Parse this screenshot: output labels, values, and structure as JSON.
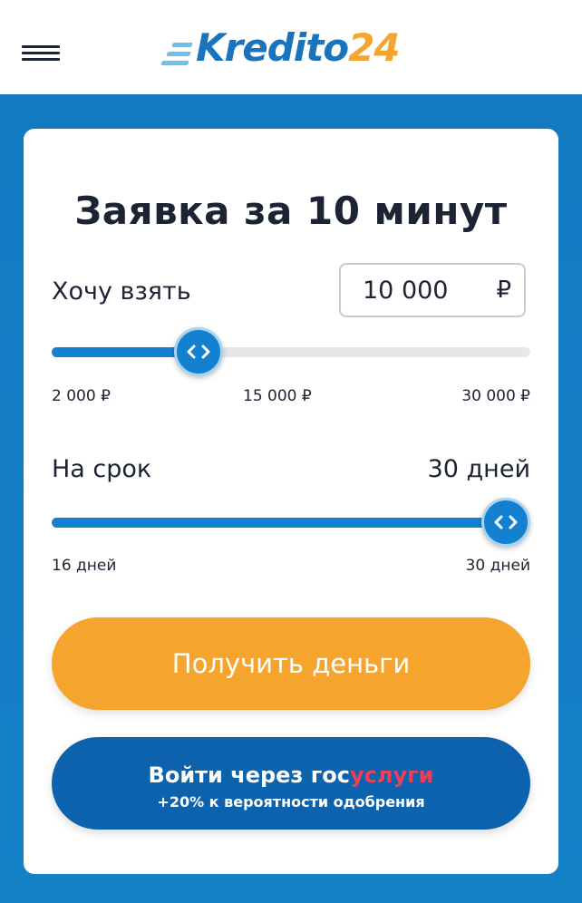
{
  "header": {
    "logo": {
      "part1": "Kredito",
      "part2": "24"
    },
    "menu_icon": "hamburger-icon"
  },
  "form": {
    "title": "Заявка за 10 минут",
    "amount": {
      "label": "Хочу взять",
      "value": "10 000",
      "currency": "₽",
      "min_label": "2 000 ₽",
      "mid_label": "15 000 ₽",
      "max_label": "30 000 ₽",
      "slider_value": 10000,
      "slider_min": 2000,
      "slider_max": 30000
    },
    "term": {
      "label": "На срок",
      "value": "30 дней",
      "min_label": "16 дней",
      "max_label": "30 дней",
      "slider_value": 30,
      "slider_min": 16,
      "slider_max": 30
    },
    "get_money_button": "Получить деньги",
    "gosuslugi_button": {
      "prefix": "Войти через ",
      "brand_gos": "гос",
      "brand_uslugi": "услуги",
      "subtext": "+20% к вероятности одобрения"
    }
  },
  "colors": {
    "brand_blue": "#1481d0",
    "accent_orange": "#f5a52e",
    "gos_blue": "#0d62ae",
    "gos_red": "#ee3f58"
  }
}
